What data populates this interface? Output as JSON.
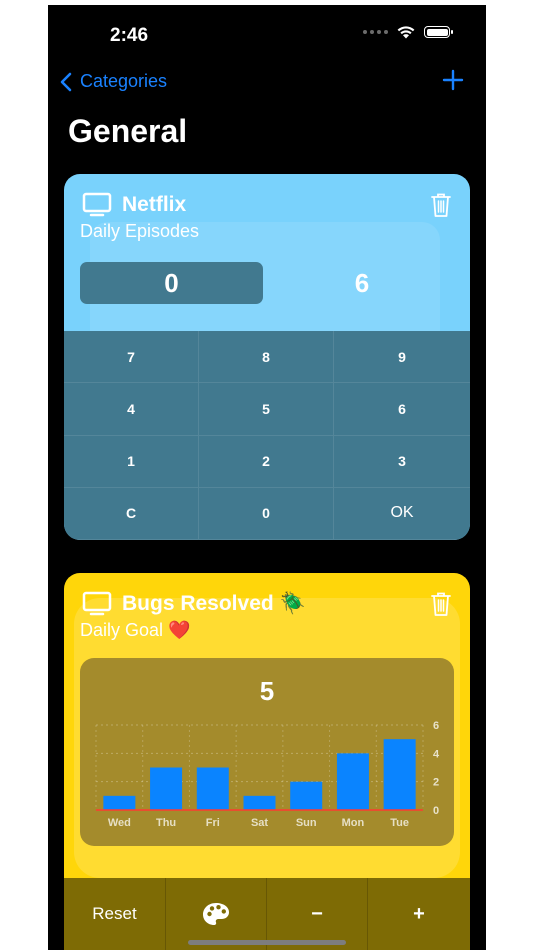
{
  "status_bar": {
    "time": "2:46"
  },
  "nav": {
    "back_label": "Categories"
  },
  "page": {
    "title": "General"
  },
  "counters": [
    {
      "title": "Netflix",
      "subtitle": "Daily Episodes",
      "icon": "tv-icon",
      "current_value": "0",
      "target_value": "6",
      "color": "#79d2fc",
      "keypad": [
        "7",
        "8",
        "9",
        "4",
        "5",
        "6",
        "1",
        "2",
        "3",
        "C",
        "0",
        "OK"
      ]
    },
    {
      "title": "Bugs Resolved 🪲",
      "subtitle": "Daily Goal ❤️",
      "icon": "tv-icon",
      "display_value": "5",
      "color": "#ffd60a",
      "actions": {
        "reset": "Reset",
        "palette": "palette-icon",
        "minus": "−",
        "plus": "+"
      }
    }
  ],
  "chart_data": {
    "type": "bar",
    "categories": [
      "Wed",
      "Thu",
      "Fri",
      "Sat",
      "Sun",
      "Mon",
      "Tue"
    ],
    "values": [
      1,
      3,
      3,
      1,
      2,
      4,
      5
    ],
    "ylim": [
      0,
      6
    ],
    "yticks": [
      "0",
      "2",
      "4",
      "6"
    ],
    "goal_line": 0,
    "bar_color": "#0a84ff",
    "goal_color": "#ff3b30",
    "grid": true
  }
}
